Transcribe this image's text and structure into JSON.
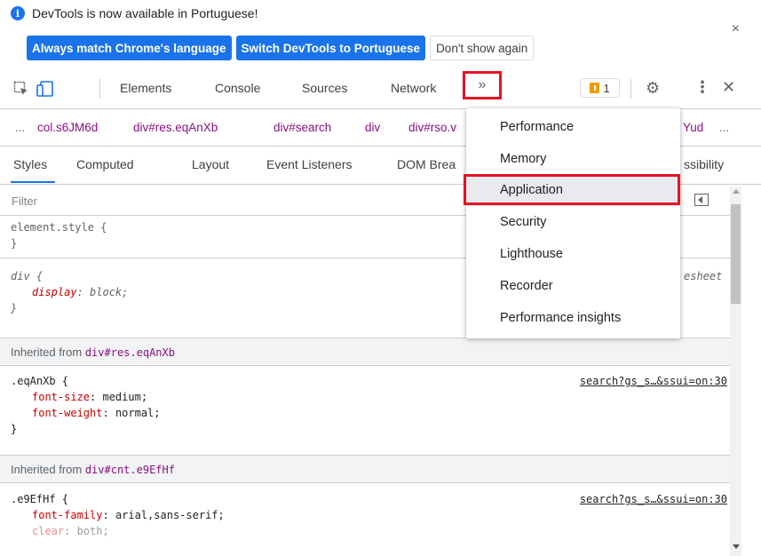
{
  "infobar": {
    "message": "DevTools is now available in Portuguese!",
    "buttons": [
      "Always match Chrome's language",
      "Switch DevTools to Portuguese",
      "Don't show again"
    ],
    "close": "×"
  },
  "main_tabs": [
    "Elements",
    "Console",
    "Sources",
    "Network"
  ],
  "more_tabs_glyph": "»",
  "issues_count": "1",
  "breadcrumbs": {
    "ellipsis": "...",
    "items": [
      "col.s6JM6d",
      "div#res.eqAnXb",
      "div#search",
      "div",
      "div#rso.v"
    ],
    "right_item": "Yud",
    "right_ellipsis": "..."
  },
  "sub_tabs": [
    "Styles",
    "Computed",
    "Layout",
    "Event Listeners",
    "DOM Brea",
    "ssibility"
  ],
  "filter_placeholder": "Filter",
  "styles": {
    "element_style": "element.style {",
    "close_brace": "}",
    "div_rule": "div {",
    "display_prop": "display",
    "display_val": "block;",
    "div_source": "esheet",
    "inherit1_prefix": "Inherited from ",
    "inherit1_sel": "div#res.eqAnXb",
    "eq_rule": ".eqAnXb {",
    "eq_source": "search?gs_s…&ssui=on:30",
    "font_size_prop": "font-size",
    "font_size_val": "medium;",
    "font_weight_prop": "font-weight",
    "font_weight_val": "normal;",
    "inherit2_prefix": "Inherited from ",
    "inherit2_sel": "div#cnt.e9EfHf",
    "e9_rule": ".e9EfHf {",
    "e9_source": "search?gs_s…&ssui=on:30",
    "font_family_prop": "font-family",
    "font_family_val": "arial,sans-serif;",
    "clear_prop": "clear",
    "clear_val": "both;"
  },
  "menu_items": [
    "Performance",
    "Memory",
    "Application",
    "Security",
    "Lighthouse",
    "Recorder",
    "Performance insights"
  ],
  "colors": {
    "accent": "#1a73e8",
    "highlight_border": "#e81123",
    "selector_purple": "#881280",
    "property_red": "#c80000"
  }
}
